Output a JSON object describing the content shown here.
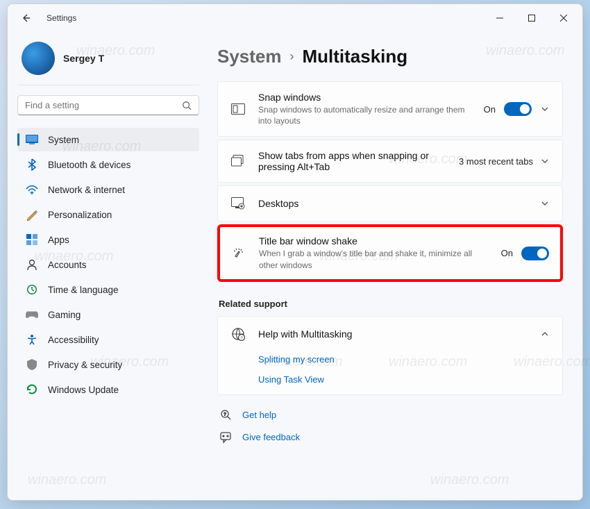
{
  "window": {
    "title": "Settings"
  },
  "profile": {
    "name": "Sergey T"
  },
  "search": {
    "placeholder": "Find a setting"
  },
  "sidebar": {
    "items": [
      {
        "label": "System",
        "icon": "system-icon",
        "active": true
      },
      {
        "label": "Bluetooth & devices",
        "icon": "bluetooth-icon"
      },
      {
        "label": "Network & internet",
        "icon": "network-icon"
      },
      {
        "label": "Personalization",
        "icon": "personalization-icon"
      },
      {
        "label": "Apps",
        "icon": "apps-icon"
      },
      {
        "label": "Accounts",
        "icon": "accounts-icon"
      },
      {
        "label": "Time & language",
        "icon": "time-icon"
      },
      {
        "label": "Gaming",
        "icon": "gaming-icon"
      },
      {
        "label": "Accessibility",
        "icon": "accessibility-icon"
      },
      {
        "label": "Privacy & security",
        "icon": "privacy-icon"
      },
      {
        "label": "Windows Update",
        "icon": "update-icon"
      }
    ]
  },
  "breadcrumb": {
    "parent": "System",
    "current": "Multitasking"
  },
  "cards": {
    "snap": {
      "title": "Snap windows",
      "desc": "Snap windows to automatically resize and arrange them into layouts",
      "state": "On"
    },
    "tabs": {
      "title": "Show tabs from apps when snapping or pressing Alt+Tab",
      "value": "3 most recent tabs"
    },
    "desktops": {
      "title": "Desktops"
    },
    "shake": {
      "title": "Title bar window shake",
      "desc": "When I grab a window's title bar and shake it, minimize all other windows",
      "state": "On"
    }
  },
  "related": {
    "heading": "Related support",
    "help_title": "Help with Multitasking",
    "links": [
      "Splitting my screen",
      "Using Task View"
    ]
  },
  "footer": {
    "get_help": "Get help",
    "feedback": "Give feedback"
  },
  "watermark": "winaero.com"
}
